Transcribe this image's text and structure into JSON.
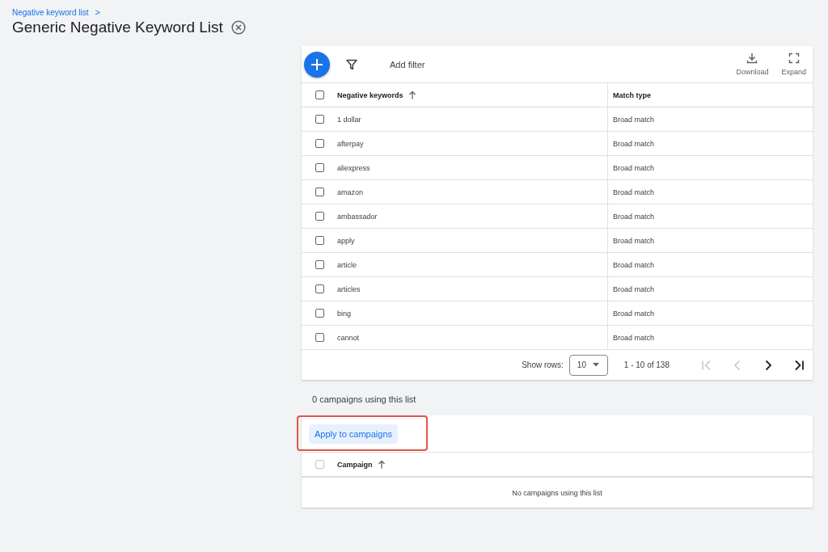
{
  "breadcrumb": {
    "label": "Negative keyword list",
    "separator": ">"
  },
  "title": "Generic Negative Keyword List",
  "toolbar": {
    "add_filter": "Add filter",
    "actions": [
      {
        "kind": "download",
        "label": "Download"
      },
      {
        "kind": "expand",
        "label": "Expand"
      }
    ]
  },
  "keywords_table": {
    "select_all_checked": false,
    "columns": [
      {
        "label": "Negative keywords",
        "sorted": true
      },
      {
        "label": "Match type",
        "sorted": false
      }
    ],
    "rows": [
      {
        "keyword": "1 dollar",
        "match_type": "Broad match",
        "checked": false
      },
      {
        "keyword": "afterpay",
        "match_type": "Broad match",
        "checked": false
      },
      {
        "keyword": "aliexpress",
        "match_type": "Broad match",
        "checked": false
      },
      {
        "keyword": "amazon",
        "match_type": "Broad match",
        "checked": false
      },
      {
        "keyword": "ambassador",
        "match_type": "Broad match",
        "checked": false
      },
      {
        "keyword": "apply",
        "match_type": "Broad match",
        "checked": false
      },
      {
        "keyword": "article",
        "match_type": "Broad match",
        "checked": false
      },
      {
        "keyword": "articles",
        "match_type": "Broad match",
        "checked": false
      },
      {
        "keyword": "bing",
        "match_type": "Broad match",
        "checked": false
      },
      {
        "keyword": "cannot",
        "match_type": "Broad match",
        "checked": false
      }
    ]
  },
  "pagination": {
    "show_rows_label": "Show rows:",
    "rows_per_page": "10",
    "range": "1 - 10 of 138",
    "first_disabled": true,
    "prev_disabled": true,
    "next_disabled": false,
    "last_disabled": false
  },
  "campaigns": {
    "summary": "0 campaigns using this list",
    "apply_button": {
      "label": "Apply to campaigns",
      "highlighted": true
    },
    "select_all_disabled": true,
    "column": "Campaign",
    "empty_message": "No campaigns using this list"
  }
}
